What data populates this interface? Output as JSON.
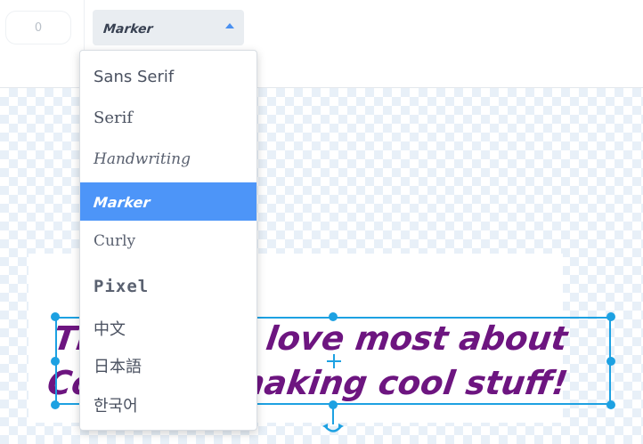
{
  "toolbar": {
    "number_value": "0",
    "font_select": {
      "selected_label": "Marker",
      "caret_icon": "caret-up-icon"
    }
  },
  "font_dropdown": {
    "items": [
      {
        "label": "Sans Serif",
        "selected": false
      },
      {
        "label": "Serif",
        "selected": false
      },
      {
        "label": "Handwriting",
        "selected": false
      },
      {
        "label": "Marker",
        "selected": true
      },
      {
        "label": "Curly",
        "selected": false
      },
      {
        "label": "Pixel",
        "selected": false
      },
      {
        "label": "中文",
        "selected": false
      },
      {
        "label": "日本語",
        "selected": false
      },
      {
        "label": "한국어",
        "selected": false
      }
    ],
    "selected_background": "#4d95f8"
  },
  "canvas": {
    "text_lines": [
      "The thing I love most about",
      "Coding is making cool stuff!"
    ],
    "text_color": "#6d1580",
    "selection_color": "#1da1e2",
    "icons": {
      "move": "move-icon",
      "rotate": "rotate-icon"
    }
  }
}
